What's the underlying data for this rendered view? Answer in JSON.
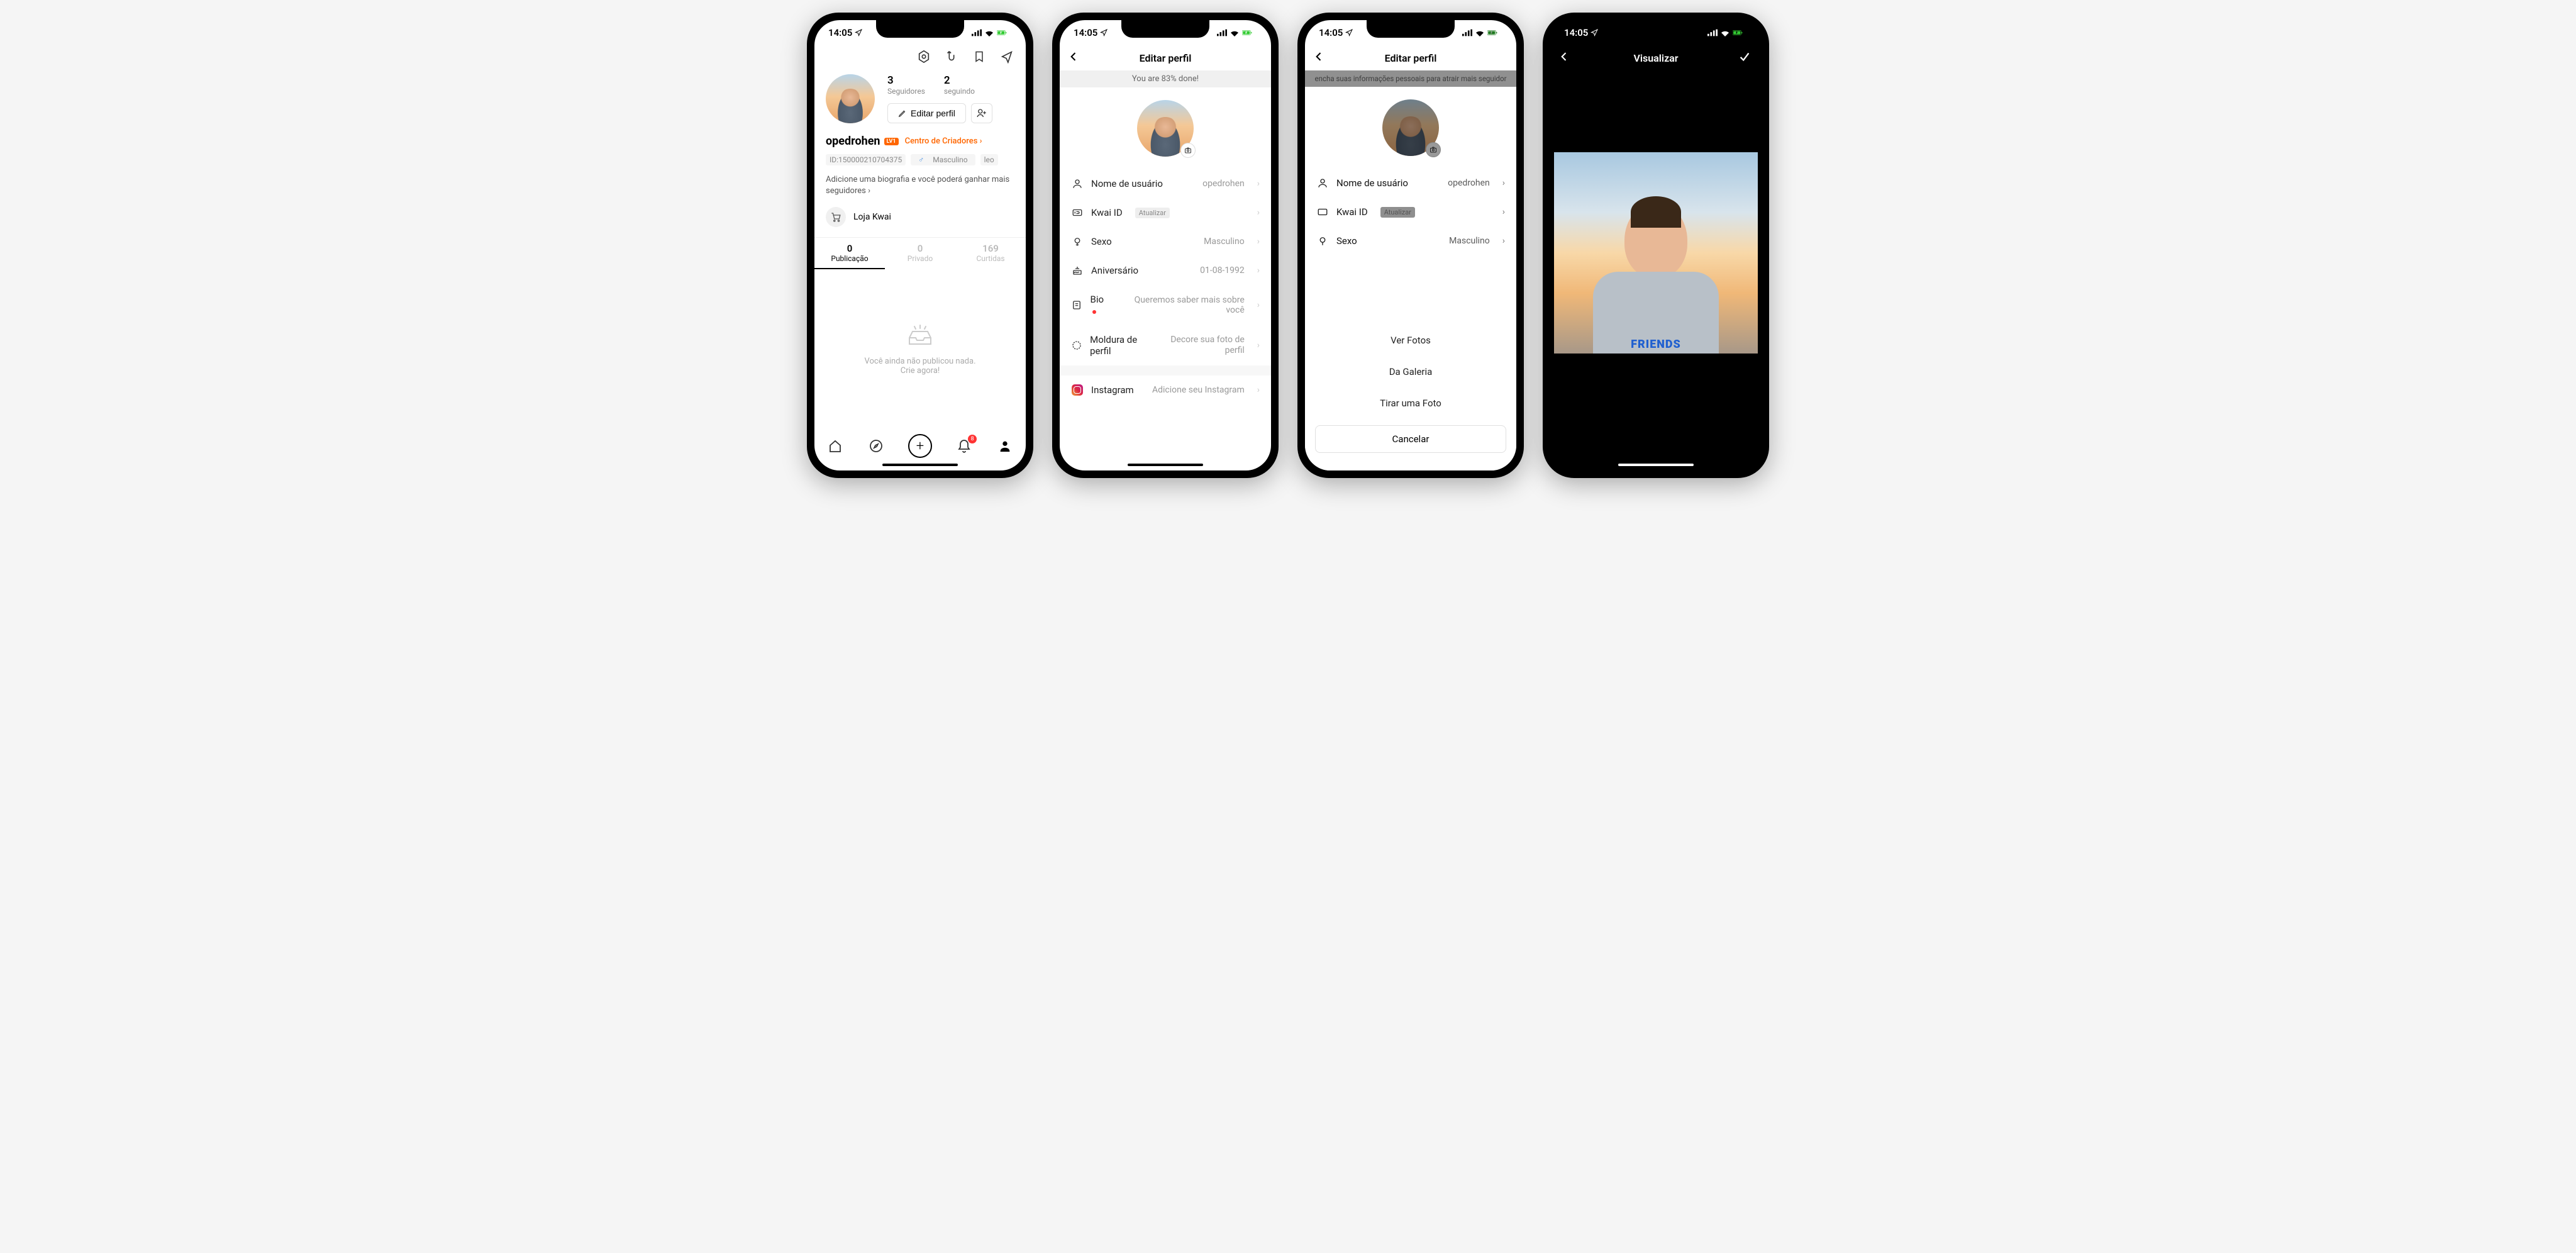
{
  "status": {
    "time": "14:05"
  },
  "screen1": {
    "followers_count": "3",
    "followers_label": "Seguidores",
    "following_count": "2",
    "following_label": "seguindo",
    "edit_profile": "Editar perfil",
    "username": "opedrohen",
    "level_badge": "LV1",
    "creator_center": "Centro de Criadores ›",
    "id_tag": "ID:150000210704375",
    "gender_tag": "Masculino",
    "zodiac_tag": "leo",
    "bio_prompt": "Adicione uma biografia e você poderá ganhar mais seguidores ›",
    "store": "Loja Kwai",
    "tabs": {
      "pub_n": "0",
      "pub_label": "Publicação",
      "priv_n": "0",
      "priv_label": "Privado",
      "likes_n": "169",
      "likes_label": "Curtidas"
    },
    "empty_line1": "Você ainda não publicou nada.",
    "empty_line2": "Crie agora!",
    "notif_count": "8"
  },
  "screen2": {
    "title": "Editar perfil",
    "progress": "You are 83% done!",
    "items": {
      "username_label": "Nome de usuário",
      "username_value": "opedrohen",
      "kwai_label": "Kwai ID",
      "kwai_value": "Atualizar",
      "gender_label": "Sexo",
      "gender_value": "Masculino",
      "bday_label": "Aniversário",
      "bday_value": "01-08-1992",
      "bio_label": "Bio",
      "bio_value": "Queremos saber mais sobre você",
      "frame_label": "Moldura de perfil",
      "frame_value": "Decore sua foto de perfil",
      "insta_label": "Instagram",
      "insta_value": "Adicione seu Instagram"
    }
  },
  "screen3": {
    "title": "Editar perfil",
    "info_banner": "encha suas informações pessoais para atrair mais seguidor",
    "items": {
      "username_label": "Nome de usuário",
      "username_value": "opedrohen",
      "kwai_label": "Kwai ID",
      "kwai_value": "Atualizar",
      "gender_label": "Sexo",
      "gender_value": "Masculino"
    },
    "sheet": {
      "view": "Ver Fotos",
      "gallery": "Da Galeria",
      "take": "Tirar uma Foto",
      "cancel": "Cancelar"
    }
  },
  "screen4": {
    "title": "Visualizar",
    "shirt_text": "FRIENDS"
  }
}
